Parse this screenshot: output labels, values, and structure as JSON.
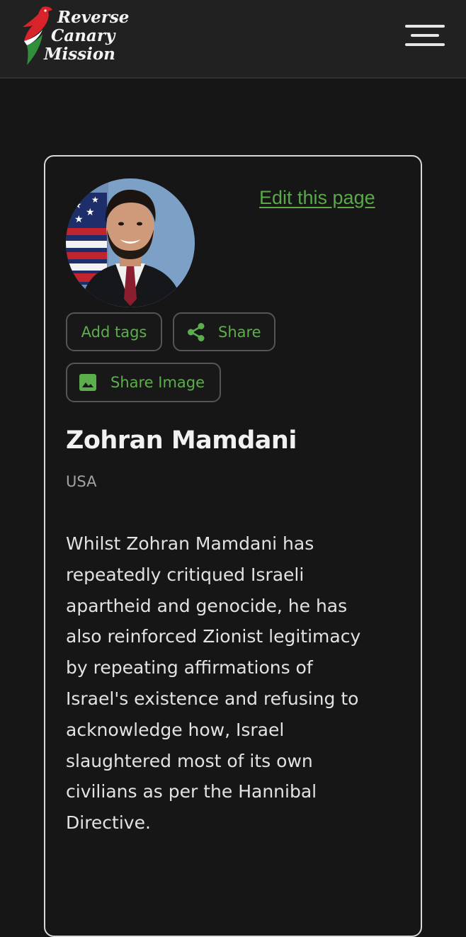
{
  "header": {
    "logo_lines": [
      "Reverse",
      "Canary",
      "Mission"
    ],
    "menu_icon": "hamburger-menu-icon"
  },
  "profile": {
    "edit_link": "Edit this page",
    "add_tags_label": "Add tags",
    "share_label": "Share",
    "share_icon": "share-icon",
    "share_image_label": "Share Image",
    "share_image_icon": "image-icon",
    "name": "Zohran Mamdani",
    "country": "USA",
    "bio_lines": [
      "Whilst Zohran Mamdani has",
      "repeatedly critiqued Israeli",
      "apartheid and genocide, he has",
      "also reinforced Zionist legitimacy",
      "by repeating affirmations of",
      "Israel's existence and refusing to",
      "acknowledge how, Israel",
      "slaughtered most of its own",
      "civilians as per the Hannibal",
      "Directive."
    ]
  },
  "colors": {
    "accent_green": "#5aa84a",
    "background": "#161616",
    "header_background": "#212121",
    "logo_red": "#d8232a",
    "logo_green": "#2f8f3a"
  }
}
